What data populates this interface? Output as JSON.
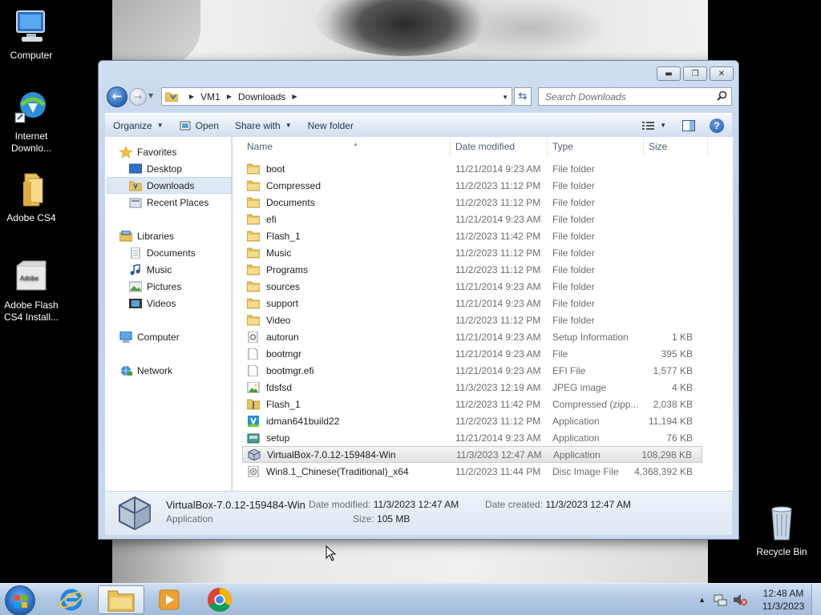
{
  "desktop": {
    "icons": [
      {
        "label": "Computer"
      },
      {
        "label": "Internet Downlo..."
      },
      {
        "label": "Adobe CS4"
      },
      {
        "label": "Adobe Flash CS4 Install..."
      },
      {
        "label": "Recycle Bin"
      }
    ]
  },
  "window": {
    "breadcrumb": [
      "VM1",
      "Downloads"
    ],
    "search_placeholder": "Search Downloads",
    "toolbar": {
      "organize": "Organize",
      "open": "Open",
      "share_with": "Share with",
      "new_folder": "New folder"
    },
    "nav": {
      "favorites": "Favorites",
      "desktop": "Desktop",
      "downloads": "Downloads",
      "recent": "Recent Places",
      "libraries": "Libraries",
      "documents": "Documents",
      "music": "Music",
      "pictures": "Pictures",
      "videos": "Videos",
      "computer": "Computer",
      "network": "Network"
    },
    "columns": {
      "name": "Name",
      "date": "Date modified",
      "type": "Type",
      "size": "Size"
    },
    "files": [
      {
        "name": "boot",
        "date": "11/21/2014 9:23 AM",
        "type": "File folder",
        "size": "",
        "icon": "folder-icon"
      },
      {
        "name": "Compressed",
        "date": "11/2/2023 11:12 PM",
        "type": "File folder",
        "size": "",
        "icon": "folder-icon"
      },
      {
        "name": "Documents",
        "date": "11/2/2023 11:12 PM",
        "type": "File folder",
        "size": "",
        "icon": "folder-icon"
      },
      {
        "name": "efi",
        "date": "11/21/2014 9:23 AM",
        "type": "File folder",
        "size": "",
        "icon": "folder-icon"
      },
      {
        "name": "Flash_1",
        "date": "11/2/2023 11:42 PM",
        "type": "File folder",
        "size": "",
        "icon": "folder-icon"
      },
      {
        "name": "Music",
        "date": "11/2/2023 11:12 PM",
        "type": "File folder",
        "size": "",
        "icon": "folder-icon"
      },
      {
        "name": "Programs",
        "date": "11/2/2023 11:12 PM",
        "type": "File folder",
        "size": "",
        "icon": "folder-icon"
      },
      {
        "name": "sources",
        "date": "11/21/2014 9:23 AM",
        "type": "File folder",
        "size": "",
        "icon": "folder-icon"
      },
      {
        "name": "support",
        "date": "11/21/2014 9:23 AM",
        "type": "File folder",
        "size": "",
        "icon": "folder-icon"
      },
      {
        "name": "Video",
        "date": "11/2/2023 11:12 PM",
        "type": "File folder",
        "size": "",
        "icon": "folder-icon"
      },
      {
        "name": "autorun",
        "date": "11/21/2014 9:23 AM",
        "type": "Setup Information",
        "size": "1 KB",
        "icon": "setup-info-icon"
      },
      {
        "name": "bootmgr",
        "date": "11/21/2014 9:23 AM",
        "type": "File",
        "size": "395 KB",
        "icon": "file-icon"
      },
      {
        "name": "bootmgr.efi",
        "date": "11/21/2014 9:23 AM",
        "type": "EFI File",
        "size": "1,577 KB",
        "icon": "file-icon"
      },
      {
        "name": "fdsfsd",
        "date": "11/3/2023 12:19 AM",
        "type": "JPEG image",
        "size": "4 KB",
        "icon": "image-icon"
      },
      {
        "name": "Flash_1",
        "date": "11/2/2023 11:42 PM",
        "type": "Compressed (zipp...",
        "size": "2,038 KB",
        "icon": "zip-icon"
      },
      {
        "name": "idman641build22",
        "date": "11/2/2023 11:12 PM",
        "type": "Application",
        "size": "11,194 KB",
        "icon": "idm-app-icon"
      },
      {
        "name": "setup",
        "date": "11/21/2014 9:23 AM",
        "type": "Application",
        "size": "76 KB",
        "icon": "setup-app-icon"
      },
      {
        "name": "VirtualBox-7.0.12-159484-Win",
        "date": "11/3/2023 12:47 AM",
        "type": "Application",
        "size": "108,298 KB",
        "icon": "virtualbox-icon",
        "selected": true
      },
      {
        "name": "Win8.1_Chinese(Traditional)_x64",
        "date": "11/2/2023 11:44 PM",
        "type": "Disc Image File",
        "size": "4,368,392 KB",
        "icon": "disc-image-icon"
      }
    ],
    "details": {
      "name": "VirtualBox-7.0.12-159484-Win",
      "type": "Application",
      "date_modified_label": "Date modified:",
      "date_modified": "11/3/2023 12:47 AM",
      "date_created_label": "Date created:",
      "date_created": "11/3/2023 12:47 AM",
      "size_label": "Size:",
      "size": "105 MB"
    }
  },
  "taskbar": {
    "time": "12:48 AM",
    "date": "11/3/2023"
  }
}
